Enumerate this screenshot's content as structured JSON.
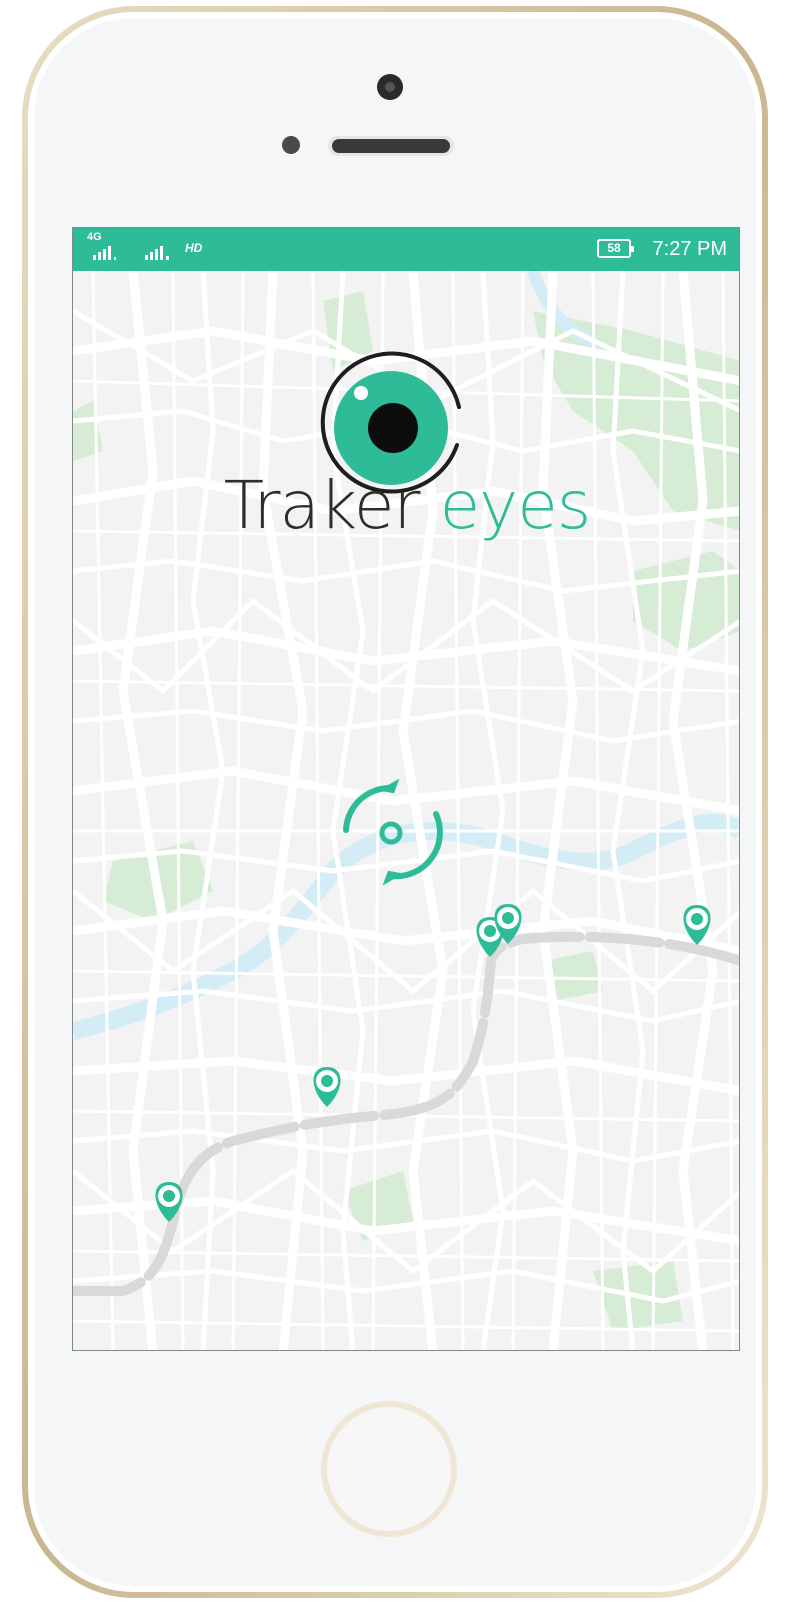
{
  "status_bar": {
    "network": "4G",
    "hd": "HD",
    "battery": "58",
    "time": "7:27 PM"
  },
  "brand": {
    "word1": "Traker",
    "word2": "eyes"
  },
  "colors": {
    "accent": "#2ebc98",
    "status_bar": "#2ebc98",
    "map_background": "#f3f3f3",
    "road": "#ffffff",
    "park": "#d6ecd4",
    "water": "#d3ecf5",
    "route": "#d6d6d6",
    "text_dark": "#2d2d2d"
  },
  "icons": {
    "logo": "eye-logo-icon",
    "refresh": "refresh-locate-icon",
    "pin": "map-pin-icon"
  }
}
